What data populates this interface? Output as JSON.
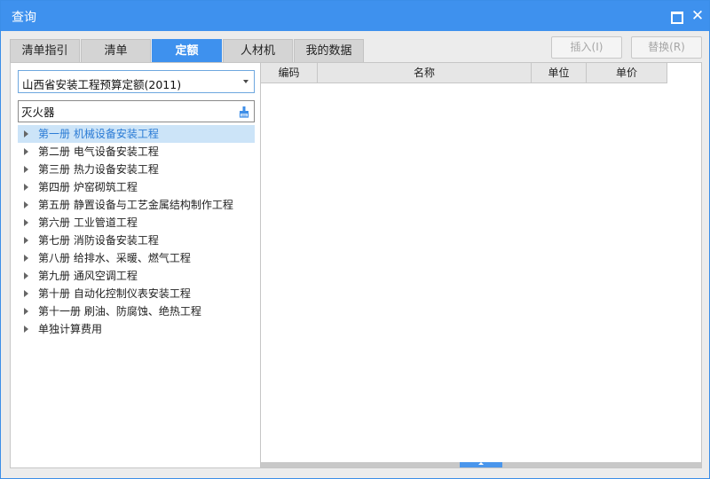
{
  "window": {
    "title": "查询"
  },
  "tabs": [
    {
      "label": "清单指引",
      "active": false
    },
    {
      "label": "清单",
      "active": false
    },
    {
      "label": "定额",
      "active": true
    },
    {
      "label": "人材机",
      "active": false
    },
    {
      "label": "我的数据",
      "active": false
    }
  ],
  "actions": {
    "insert_label": "插入(I)",
    "replace_label": "替换(R)"
  },
  "left": {
    "quota_library": "山西省安装工程预算定额(2011)",
    "search_value": "灭火器",
    "tree": [
      {
        "label": "第一册 机械设备安装工程",
        "selected": true
      },
      {
        "label": "第二册 电气设备安装工程"
      },
      {
        "label": "第三册 热力设备安装工程"
      },
      {
        "label": "第四册 炉窑砌筑工程"
      },
      {
        "label": "第五册 静置设备与工艺金属结构制作工程"
      },
      {
        "label": "第六册 工业管道工程"
      },
      {
        "label": "第七册 消防设备安装工程"
      },
      {
        "label": "第八册 给排水、采暖、燃气工程"
      },
      {
        "label": "第九册 通风空调工程"
      },
      {
        "label": "第十册 自动化控制仪表安装工程"
      },
      {
        "label": "第十一册 刷油、防腐蚀、绝热工程"
      },
      {
        "label": "单独计算费用"
      }
    ]
  },
  "grid": {
    "columns": [
      "编码",
      "名称",
      "单位",
      "单价"
    ],
    "rows": []
  },
  "icons": {
    "maximize": "maximize-icon",
    "close": "close-icon",
    "combo_arrow": "chevron-down-icon",
    "search": "clear-search-icon",
    "tree_arrow": "caret-right-icon"
  },
  "colors": {
    "accent": "#3e91ee",
    "selected_row": "#cce4f8",
    "selected_text": "#2a7bd5"
  }
}
